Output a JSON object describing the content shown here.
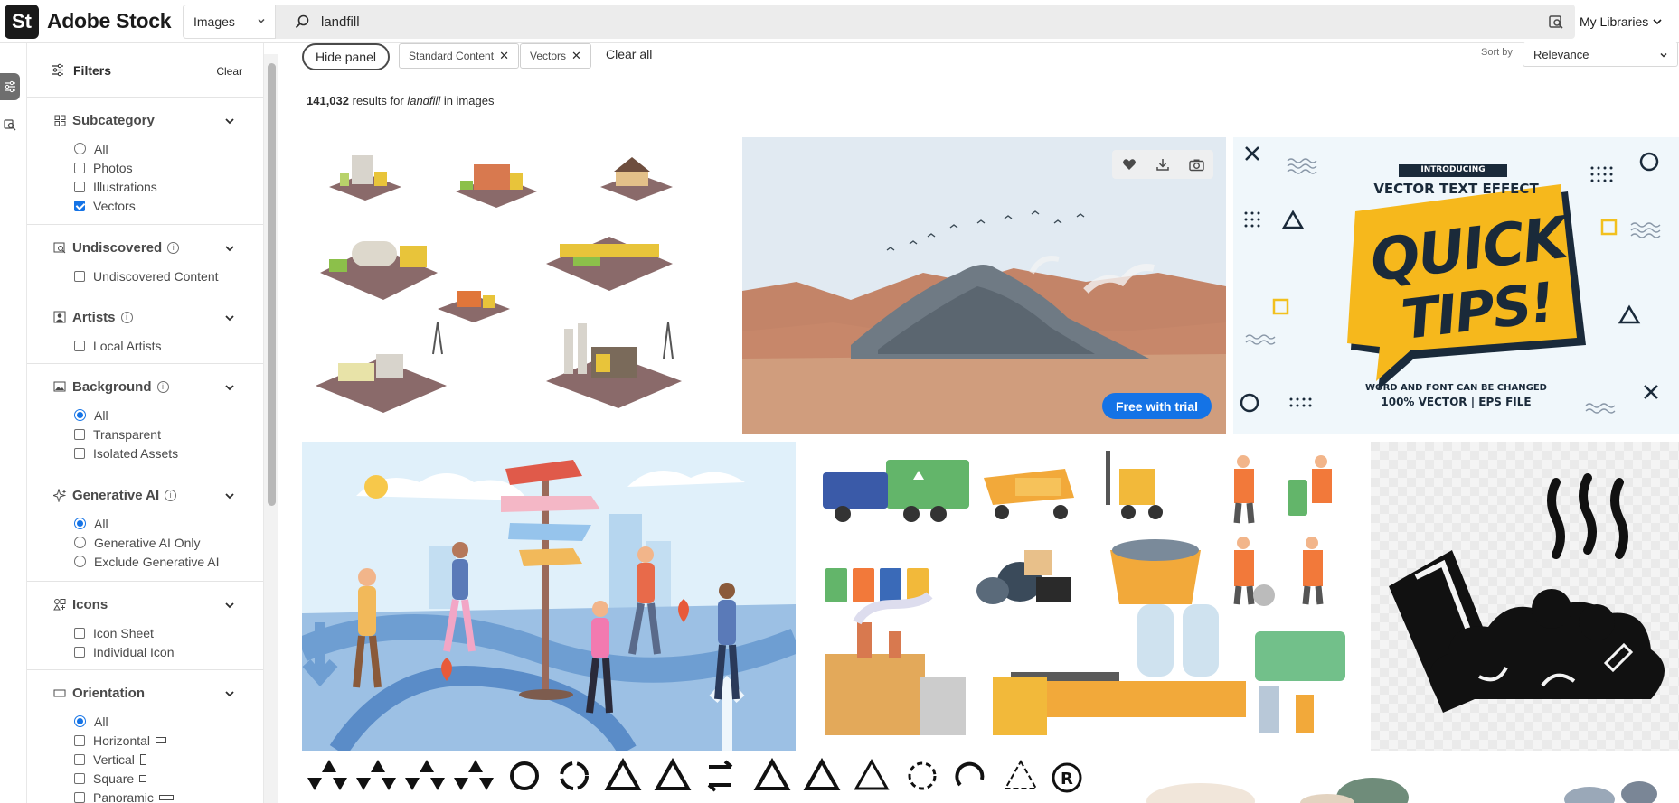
{
  "header": {
    "logo_badge": "St",
    "logo_text": "Adobe Stock",
    "search_category": "Images",
    "search_value": "landfill",
    "libraries": "My Libraries"
  },
  "filters": {
    "title": "Filters",
    "clear": "Clear",
    "subcategory": {
      "title": "Subcategory",
      "options": [
        "All",
        "Photos",
        "Illustrations",
        "Vectors"
      ]
    },
    "undiscovered": {
      "title": "Undiscovered",
      "options": [
        "Undiscovered Content"
      ]
    },
    "artists": {
      "title": "Artists",
      "options": [
        "Local Artists"
      ]
    },
    "background": {
      "title": "Background",
      "options": [
        "All",
        "Transparent",
        "Isolated Assets"
      ]
    },
    "generative": {
      "title": "Generative AI",
      "options": [
        "All",
        "Generative AI Only",
        "Exclude Generative AI"
      ]
    },
    "icons": {
      "title": "Icons",
      "options": [
        "Icon Sheet",
        "Individual Icon"
      ]
    },
    "orientation": {
      "title": "Orientation",
      "options": [
        "All",
        "Horizontal",
        "Vertical",
        "Square",
        "Panoramic"
      ]
    }
  },
  "toolbar": {
    "hide_panel": "Hide panel",
    "chips": [
      "Standard Content",
      "Vectors"
    ],
    "clear_all": "Clear all",
    "sort_label": "Sort by",
    "sort_value": "Relevance"
  },
  "results": {
    "count": "141,032",
    "results_for": "results for",
    "query": "landfill",
    "in_images": "in images"
  },
  "tiles": {
    "quick_tips": {
      "introducing": "INTRODUCING",
      "subtitle": "VECTOR TEXT EFFECT",
      "word1": "QUICK",
      "word2": "TIPS!",
      "footer1": "WORD AND FONT CAN BE CHANGED",
      "footer2": "100% VECTOR | EPS FILE"
    },
    "free_with_trial": "Free with trial"
  },
  "colors": {
    "accent": "#1473e6",
    "logo_bg": "#1a1a1a"
  }
}
